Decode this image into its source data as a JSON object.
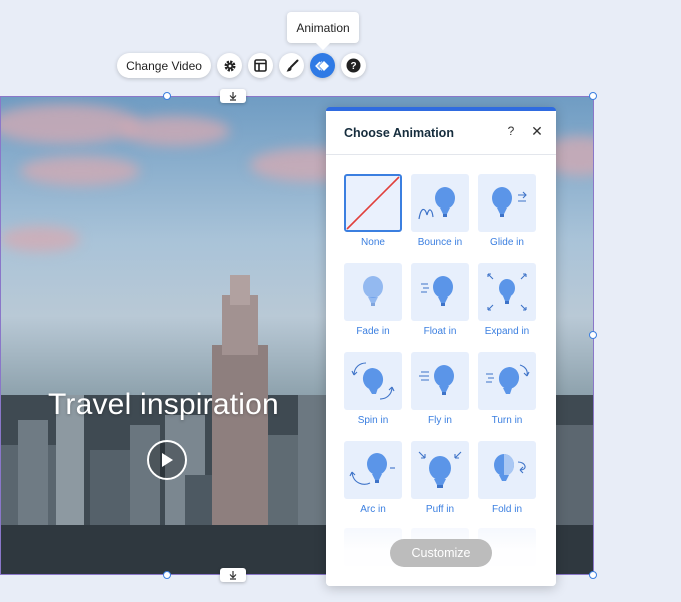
{
  "toolbar": {
    "tooltip": "Animation",
    "change_video_label": "Change Video",
    "buttons": [
      {
        "name": "settings",
        "icon": "gear-icon"
      },
      {
        "name": "layout",
        "icon": "layout-icon"
      },
      {
        "name": "design",
        "icon": "brush-icon"
      },
      {
        "name": "animation",
        "icon": "animation-icon",
        "active": true
      },
      {
        "name": "help",
        "icon": "help-icon"
      }
    ]
  },
  "video": {
    "headline": "Travel inspiration"
  },
  "panel": {
    "title": "Choose Animation",
    "help_label": "?",
    "close_label": "✕",
    "customize_label": "Customize",
    "animations": [
      {
        "label": "None",
        "selected": true
      },
      {
        "label": "Bounce in"
      },
      {
        "label": "Glide in"
      },
      {
        "label": "Fade in"
      },
      {
        "label": "Float in"
      },
      {
        "label": "Expand in"
      },
      {
        "label": "Spin in"
      },
      {
        "label": "Fly in"
      },
      {
        "label": "Turn in"
      },
      {
        "label": "Arc in"
      },
      {
        "label": "Puff in"
      },
      {
        "label": "Fold in"
      }
    ]
  },
  "colors": {
    "accent": "#2f7ae5",
    "label_blue": "#3b7fe0",
    "thumb_bg": "#e7effc",
    "balloon": "#5b95e8",
    "customize_disabled": "#bcbcbc"
  }
}
